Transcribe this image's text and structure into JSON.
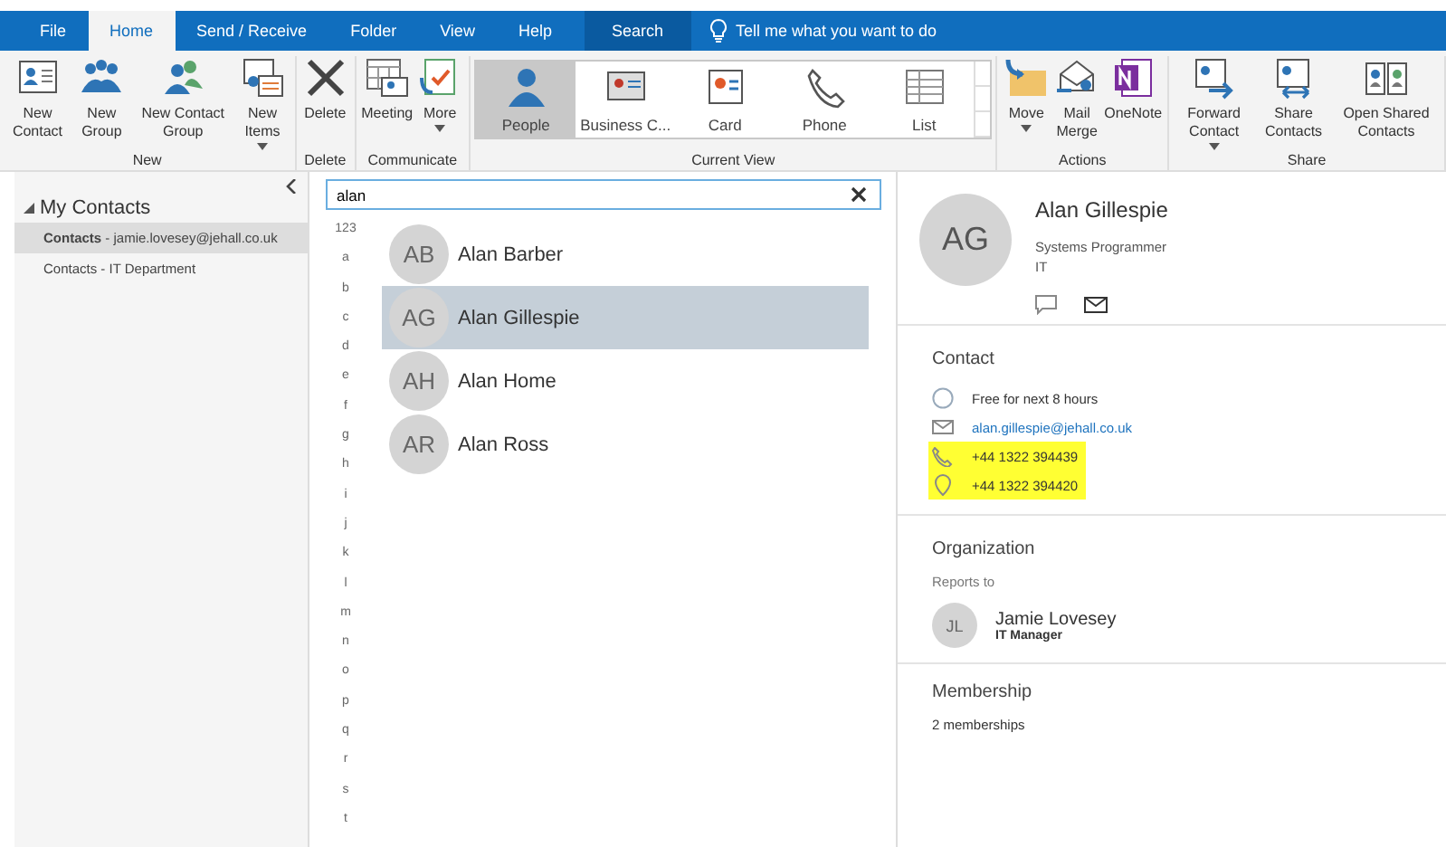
{
  "tabs": [
    {
      "label": "File",
      "kind": "file",
      "selected": false
    },
    {
      "label": "Home",
      "kind": "tab",
      "selected": true
    },
    {
      "label": "Send / Receive",
      "kind": "tab",
      "selected": false
    },
    {
      "label": "Folder",
      "kind": "tab",
      "selected": false
    },
    {
      "label": "View",
      "kind": "tab",
      "selected": false
    },
    {
      "label": "Help",
      "kind": "tab",
      "selected": false
    },
    {
      "label": "Search",
      "kind": "context",
      "selected": false
    }
  ],
  "tell_me": {
    "placeholder": "Tell me what you want to do"
  },
  "ribbon": {
    "groups": [
      {
        "label": "New",
        "kind": "buttons",
        "buttons": [
          {
            "label": "New Contact",
            "has_menu": false
          },
          {
            "label": "New Group",
            "has_menu": false
          },
          {
            "label": "New Contact Group",
            "has_menu": false
          },
          {
            "label": "New Items",
            "has_menu": true
          }
        ]
      },
      {
        "label": "Delete",
        "kind": "buttons",
        "buttons": [
          {
            "label": "Delete",
            "has_menu": false
          }
        ]
      },
      {
        "label": "Communicate",
        "kind": "buttons",
        "buttons": [
          {
            "label": "Meeting",
            "has_menu": false
          },
          {
            "label": "More",
            "has_menu": true
          }
        ]
      },
      {
        "label": "Current View",
        "kind": "gallery",
        "buttons": [
          {
            "label": "People",
            "selected": true
          },
          {
            "label": "Business C...",
            "selected": false
          },
          {
            "label": "Card",
            "selected": false
          },
          {
            "label": "Phone",
            "selected": false
          },
          {
            "label": "List",
            "selected": false
          }
        ]
      },
      {
        "label": "Actions",
        "kind": "buttons",
        "buttons": [
          {
            "label": "Move",
            "has_menu": true
          },
          {
            "label": "Mail Merge",
            "has_menu": false
          },
          {
            "label": "OneNote",
            "has_menu": false
          }
        ]
      },
      {
        "label": "Share",
        "kind": "buttons",
        "buttons": [
          {
            "label": "Forward Contact",
            "has_menu": true
          },
          {
            "label": "Share Contacts",
            "has_menu": false
          },
          {
            "label": "Open Shared Contacts",
            "has_menu": false
          }
        ]
      }
    ]
  },
  "sidebar": {
    "items": [
      {
        "label": "My Contacts",
        "expanded": true,
        "children": [
          {
            "label": "**Contacts** - jamie.lovesey@jehall.co.uk",
            "selected": true
          },
          {
            "label": "Contacts - IT Department",
            "selected": false
          }
        ]
      }
    ]
  },
  "search": {
    "value": "alan"
  },
  "index_letters": [
    "123",
    "a",
    "b",
    "c",
    "d",
    "e",
    "f",
    "g",
    "h",
    "i",
    "j",
    "k",
    "l",
    "m",
    "n",
    "o",
    "p",
    "q",
    "r",
    "s",
    "t"
  ],
  "contacts": [
    {
      "initials": "AB",
      "name": "Alan Barber",
      "selected": false
    },
    {
      "initials": "AG",
      "name": "Alan Gillespie",
      "selected": true
    },
    {
      "initials": "AH",
      "name": "Alan Home",
      "selected": false
    },
    {
      "initials": "AR",
      "name": "Alan Ross",
      "selected": false
    }
  ],
  "detail": {
    "initials": "AG",
    "name": "Alan Gillespie",
    "job_title": "Systems Programmer",
    "department": "IT",
    "contact": {
      "heading": "Contact",
      "rows": [
        {
          "kind": "presence",
          "text": "Free for next 8 hours",
          "highlighted": false
        },
        {
          "kind": "email",
          "text": "alan.gillespie@jehall.co.uk",
          "highlighted": false
        },
        {
          "kind": "phone",
          "text": "+44 1322 394439",
          "highlighted": true
        },
        {
          "kind": "location",
          "text": "+44 1322 394420",
          "highlighted": true
        }
      ]
    },
    "organization": {
      "heading": "Organization",
      "reports_to_label": "Reports to",
      "manager": {
        "initials": "JL",
        "name": "Jamie Lovesey",
        "title": "IT Manager"
      }
    },
    "membership": {
      "heading": "Membership",
      "text": "2 memberships"
    }
  }
}
